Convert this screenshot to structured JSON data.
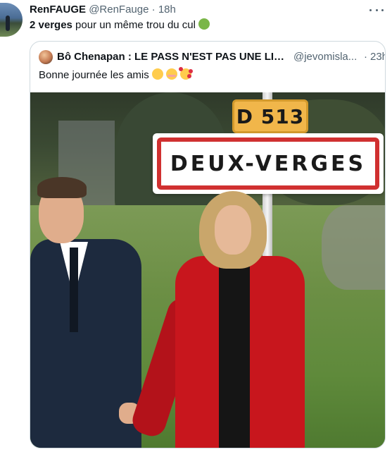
{
  "tweet": {
    "author_name": "RenFAUGE",
    "author_handle": "@RenFauge",
    "separator": "·",
    "time": "18h",
    "text_bold": "2 verges",
    "text_rest": " pour un même trou du cul ",
    "emoji": "nauseated-face"
  },
  "quote": {
    "author_name": "Bô Chenapan : LE PASS N'EST PAS UNE LIB...",
    "author_handle": "@jevomisla...",
    "separator": "·",
    "time": "23h",
    "text": "Bonne journée les amis ",
    "emojis": [
      "winking-face",
      "smiling-face-with-smiling-eyes",
      "smiling-face-with-hearts"
    ]
  },
  "photo": {
    "road_sign": "D 513",
    "town_sign": "DEUX-VERGES"
  },
  "colors": {
    "text_primary": "#0f1419",
    "text_secondary": "#536471",
    "border": "#cfd9de",
    "sign_red": "#d03030",
    "sign_yellow": "#f1b64a"
  }
}
